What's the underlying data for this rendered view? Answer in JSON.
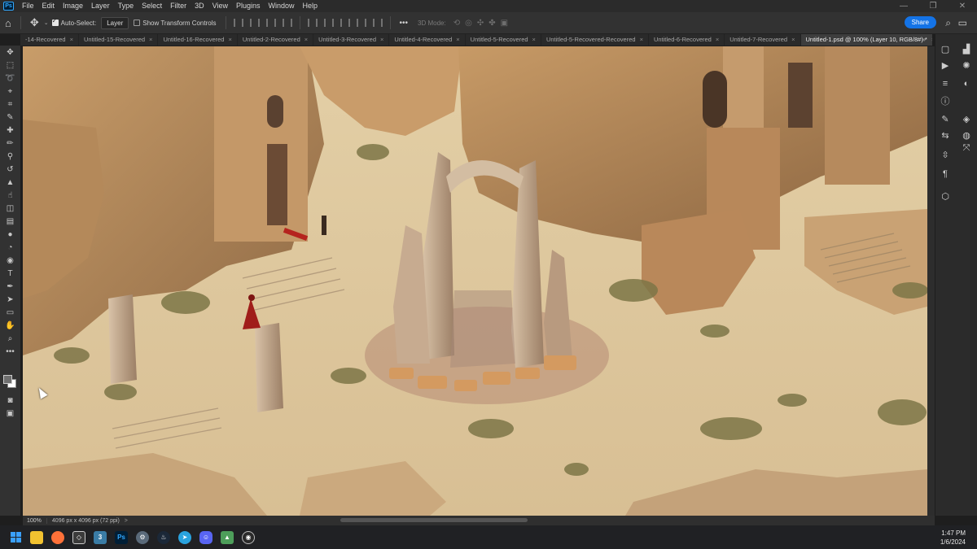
{
  "menubar": {
    "app_icon": "Ps",
    "items": [
      "File",
      "Edit",
      "Image",
      "Layer",
      "Type",
      "Select",
      "Filter",
      "3D",
      "View",
      "Plugins",
      "Window",
      "Help"
    ],
    "window_controls": [
      "minimize-icon",
      "restore-icon",
      "close-icon"
    ]
  },
  "options": {
    "auto_select_label": "Auto-Select:",
    "auto_select_checked": true,
    "auto_select_value": "Layer",
    "transform_controls_label": "Show Transform Controls",
    "transform_controls_checked": false,
    "more_label": "•••",
    "mode_3d_label": "3D Mode:",
    "share_label": "Share"
  },
  "tabs": [
    {
      "label": "-14-Recovered",
      "active": false
    },
    {
      "label": "Untitled-15-Recovered",
      "active": false
    },
    {
      "label": "Untitled-16-Recovered",
      "active": false
    },
    {
      "label": "Untitled-2-Recovered",
      "active": false
    },
    {
      "label": "Untitled-3-Recovered",
      "active": false
    },
    {
      "label": "Untitled-4-Recovered",
      "active": false
    },
    {
      "label": "Untitled-5-Recovered",
      "active": false
    },
    {
      "label": "Untitled-5-Recovered-Recovered",
      "active": false
    },
    {
      "label": "Untitled-6-Recovered",
      "active": false
    },
    {
      "label": "Untitled-7-Recovered",
      "active": false
    },
    {
      "label": "Untitled-1.psd @ 100% (Layer 10, RGB/8#) *",
      "active": true
    }
  ],
  "tab_more": "»",
  "status": {
    "zoom": "100%",
    "doc_info": "4096 px x 4096 px (72 ppi)",
    "arrow": ">"
  },
  "colors": {
    "accent": "#1473e6",
    "foreground_swatch": "#6f6f6f",
    "background_swatch": "#ffffff"
  },
  "taskbar": {
    "apps": [
      "windows-start-icon",
      "file-explorer-icon",
      "firefox-icon",
      "unity-icon",
      "app-3-icon",
      "photoshop-icon",
      "settings-icon",
      "steam-icon",
      "telegram-icon",
      "discord-icon",
      "photos-icon",
      "obs-icon"
    ],
    "time": "1:47 PM",
    "date": "1/6/2024"
  }
}
